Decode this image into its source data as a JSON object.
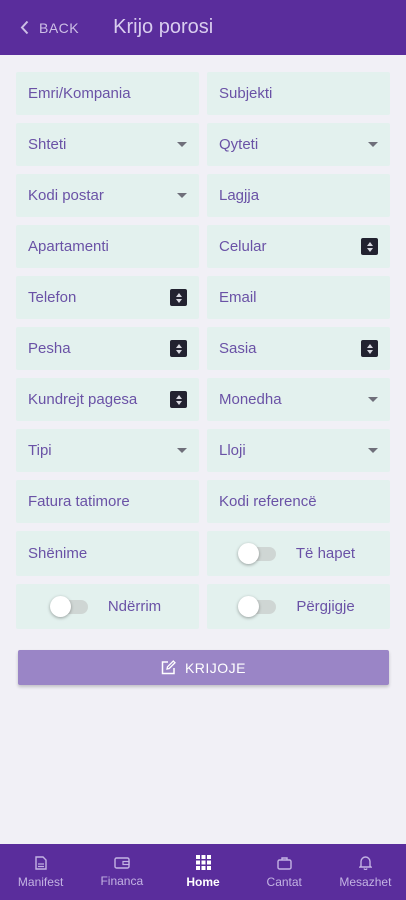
{
  "header": {
    "back_label": "BACK",
    "title": "Krijo porosi"
  },
  "form": {
    "emri": "Emri/Kompania",
    "subjekti": "Subjekti",
    "shteti": "Shteti",
    "qyteti": "Qyteti",
    "kodi_postar": "Kodi postar",
    "lagjja": "Lagjja",
    "apartamenti": "Apartamenti",
    "celular": "Celular",
    "telefon": "Telefon",
    "email": "Email",
    "pesha": "Pesha",
    "sasia": "Sasia",
    "kundrejt_pagesa": "Kundrejt pagesa",
    "monedha": "Monedha",
    "tipi": "Tipi",
    "lloji": "Lloji",
    "fatura_tatimore": "Fatura tatimore",
    "kodi_references": "Kodi referencë",
    "shenime": "Shënime",
    "te_hapet": "Të hapet",
    "nderrim": "Ndërrim",
    "pergjigje": "Përgjigje"
  },
  "create_label": "KRIJOJE",
  "nav": {
    "items": [
      {
        "label": "Manifest",
        "icon": "document-icon"
      },
      {
        "label": "Financa",
        "icon": "wallet-icon"
      },
      {
        "label": "Home",
        "icon": "grid-icon"
      },
      {
        "label": "Cantat",
        "icon": "bag-icon"
      },
      {
        "label": "Mesazhet",
        "icon": "bell-icon"
      }
    ],
    "active": "Home"
  },
  "colors": {
    "primary": "#5a2d9c",
    "field_bg": "#e3f1ee",
    "button": "#9a85c6",
    "background": "#f1f0f6"
  }
}
